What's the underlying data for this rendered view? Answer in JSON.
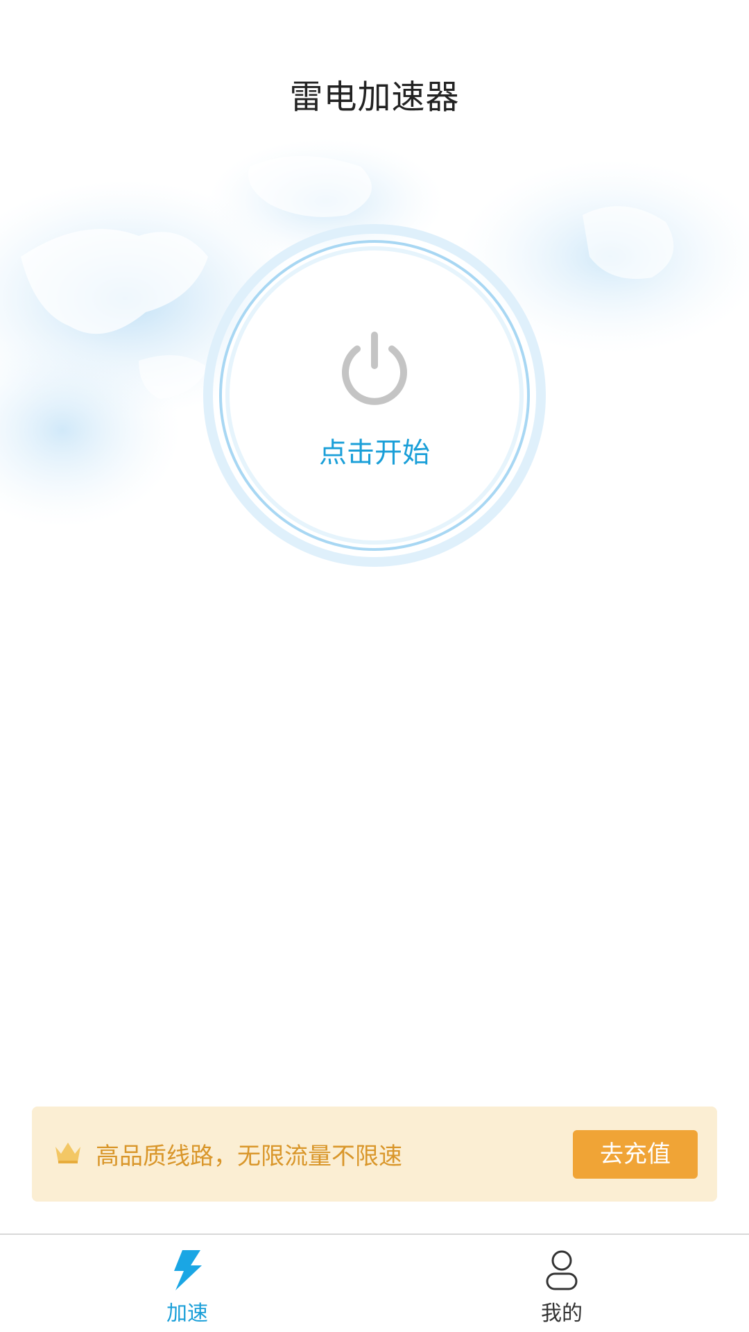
{
  "header": {
    "title": "雷电加速器"
  },
  "main": {
    "start_label": "点击开始",
    "power_icon": "power-icon",
    "background_icon": "world-map"
  },
  "promo": {
    "text": "高品质线路，无限流量不限速",
    "button_label": "去充值",
    "icon": "crown-icon"
  },
  "tabbar": {
    "tabs": [
      {
        "label": "加速",
        "icon": "lightning-icon",
        "active": true
      },
      {
        "label": "我的",
        "icon": "user-icon",
        "active": false
      }
    ]
  },
  "colors": {
    "accent": "#1a9fd8",
    "promo_bg": "#fbeed3",
    "promo_text": "#d9962a",
    "button_bg": "#f0a436",
    "title": "#222222"
  }
}
